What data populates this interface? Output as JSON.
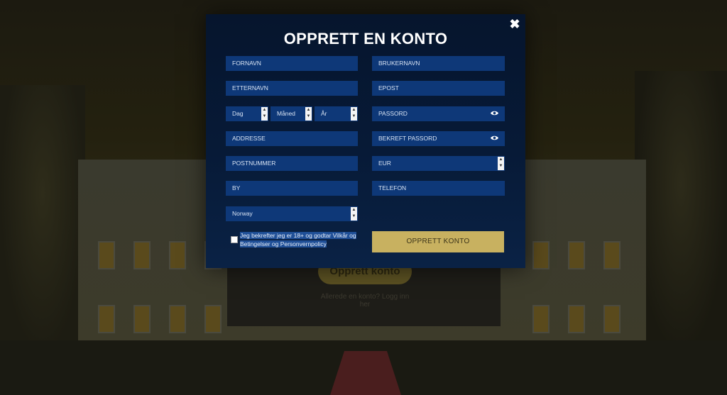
{
  "modal": {
    "title": "OPPRETT EN KONTO",
    "close_label": "✖"
  },
  "form": {
    "first_name": "FORNAVN",
    "last_name": "ETTERNAVN",
    "dob_day": "Dag",
    "dob_month": "Måned",
    "dob_year": "År",
    "address": "ADDRESSE",
    "postcode": "POSTNUMMER",
    "city": "BY",
    "country": "Norway",
    "username": "BRUKERNAVN",
    "email": "EPOST",
    "password": "PASSORD",
    "confirm_password": "BEKREFT PASSORD",
    "currency": "EUR",
    "phone": "TELEFON",
    "terms": "Jeg bekrefter jeg er 18+ og godtar Vilkår og Betingelser og Personvernpolicy",
    "submit": "OPPRETT KONTO"
  },
  "background": {
    "login_button": "Opprett konto",
    "login_link": "Allerede en konto? Logg inn her"
  },
  "colors": {
    "modal_bg": "#071a37",
    "field_bg": "#0e3878",
    "cta_bg": "#c8b160"
  },
  "icons": {
    "close": "close-icon",
    "eye": "eye-icon",
    "stepper": "up-down-arrows-icon"
  }
}
